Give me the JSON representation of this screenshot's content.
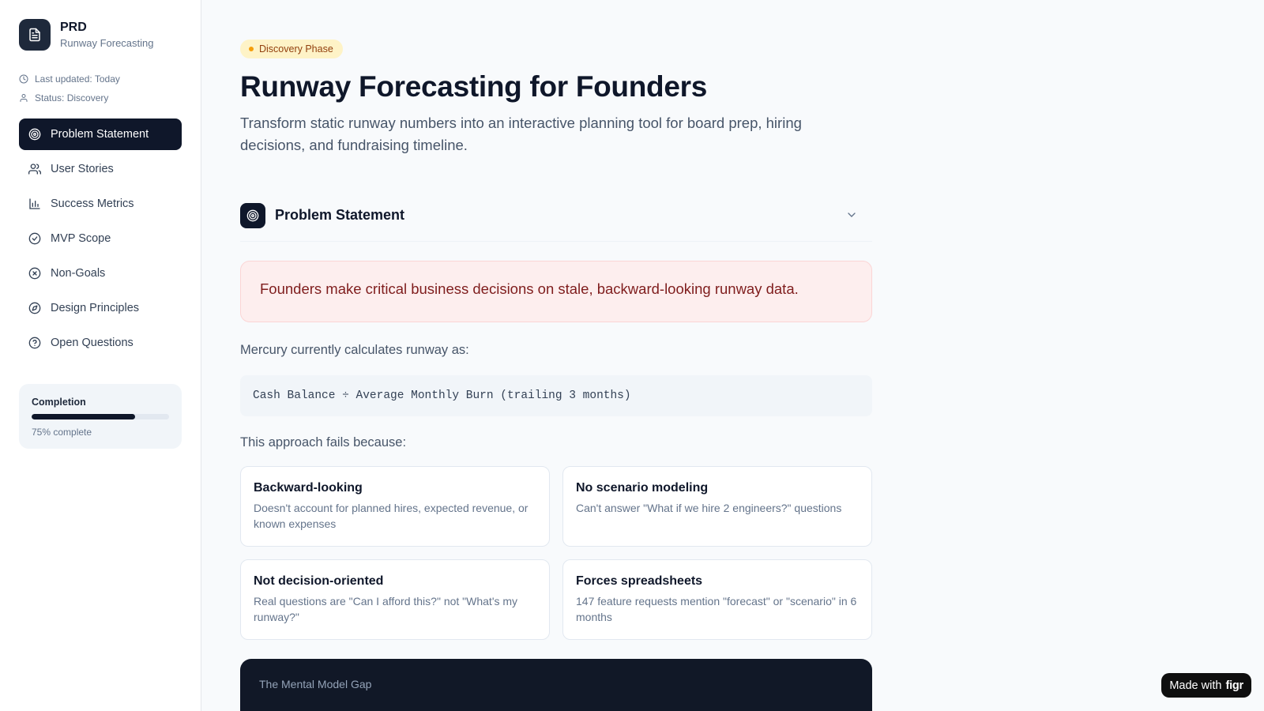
{
  "sidebar": {
    "brand_title": "PRD",
    "brand_subtitle": "Runway Forecasting",
    "last_updated": "Last updated: Today",
    "status": "Status: Discovery",
    "nav_items": [
      {
        "label": "Problem Statement",
        "icon": "target-icon",
        "active": true
      },
      {
        "label": "User Stories",
        "icon": "users-icon",
        "active": false
      },
      {
        "label": "Success Metrics",
        "icon": "bar-chart-icon",
        "active": false
      },
      {
        "label": "MVP Scope",
        "icon": "check-circle-icon",
        "active": false
      },
      {
        "label": "Non-Goals",
        "icon": "x-circle-icon",
        "active": false
      },
      {
        "label": "Design Principles",
        "icon": "compass-icon",
        "active": false
      },
      {
        "label": "Open Questions",
        "icon": "help-circle-icon",
        "active": false
      }
    ],
    "completion": {
      "label": "Completion",
      "progress": 0.75,
      "text": "75% complete"
    }
  },
  "main": {
    "phase_badge": "Discovery Phase",
    "title": "Runway Forecasting for Founders",
    "subtitle": "Transform static runway numbers into an interactive planning tool for board prep, hiring decisions, and fundraising timeline.",
    "section": {
      "title": "Problem Statement",
      "alert": "Founders make critical business decisions on stale, backward-looking runway data.",
      "intro": "Mercury currently calculates runway as:",
      "formula": "Cash Balance ÷ Average Monthly Burn (trailing 3 months)",
      "fails_intro": "This approach fails because:",
      "cards": [
        {
          "title": "Backward-looking",
          "desc": "Doesn't account for planned hires, expected revenue, or known expenses"
        },
        {
          "title": "No scenario modeling",
          "desc": "Can't answer \"What if we hire 2 engineers?\" questions"
        },
        {
          "title": "Not decision-oriented",
          "desc": "Real questions are \"Can I afford this?\" not \"What's my runway?\""
        },
        {
          "title": "Forces spreadsheets",
          "desc": "147 feature requests mention \"forecast\" or \"scenario\" in 6 months"
        }
      ],
      "dark_panel_label": "The Mental Model Gap"
    }
  },
  "badge": {
    "made_with": "Made with",
    "brand": "figr"
  },
  "colors": {
    "accent_dark": "#0f172a",
    "alert_bg": "#fdeeee",
    "alert_text": "#7f1d1d",
    "badge_bg": "#fef3c7",
    "badge_text": "#92400e"
  }
}
